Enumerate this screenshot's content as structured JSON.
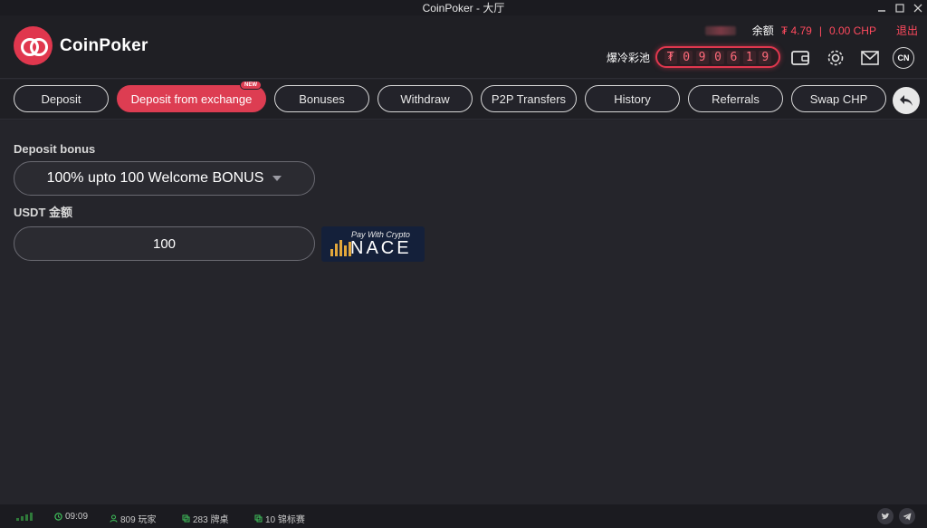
{
  "window": {
    "title": "CoinPoker - 大厅"
  },
  "header": {
    "logo_text": "CoinPoker",
    "balance_label": "余额",
    "balance_chp_token": "₮ 4.79",
    "balance_separator": "|",
    "balance_chp": "0.00 CHP",
    "logout_label": "退出",
    "jackpot_label": "爆冷彩池",
    "jackpot_currency": "₮",
    "jackpot_digits": [
      "0",
      "9",
      "0",
      "6",
      "1",
      "9"
    ],
    "language": "CN"
  },
  "tabs": [
    {
      "label": "Deposit",
      "active": false
    },
    {
      "label": "Deposit from exchange",
      "active": true,
      "badge": "NEW"
    },
    {
      "label": "Bonuses",
      "active": false
    },
    {
      "label": "Withdraw",
      "active": false
    },
    {
      "label": "P2P Transfers",
      "active": false
    },
    {
      "label": "History",
      "active": false
    },
    {
      "label": "Referrals",
      "active": false
    },
    {
      "label": "Swap CHP",
      "active": false
    }
  ],
  "form": {
    "bonus_label": "Deposit bonus",
    "bonus_selected": "100% upto 100 Welcome BONUS",
    "amount_label": "USDT 金额",
    "amount_value": "100",
    "partner_tagline": "Pay With Crypto",
    "partner_name": "NACE"
  },
  "statusbar": {
    "time": "09:09",
    "players": "809 玩家",
    "tables": "283 牌桌",
    "tournaments": "10 锦标赛"
  },
  "colors": {
    "accent": "#dd3d52",
    "background": "#25252b"
  }
}
